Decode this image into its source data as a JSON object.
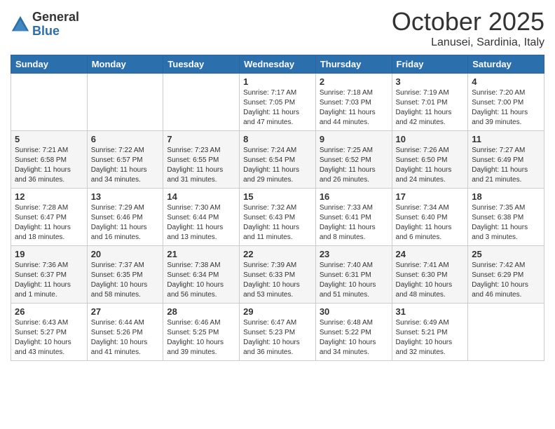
{
  "logo": {
    "general": "General",
    "blue": "Blue"
  },
  "header": {
    "month": "October 2025",
    "location": "Lanusei, Sardinia, Italy"
  },
  "days_of_week": [
    "Sunday",
    "Monday",
    "Tuesday",
    "Wednesday",
    "Thursday",
    "Friday",
    "Saturday"
  ],
  "weeks": [
    [
      {
        "day": "",
        "info": ""
      },
      {
        "day": "",
        "info": ""
      },
      {
        "day": "",
        "info": ""
      },
      {
        "day": "1",
        "info": "Sunrise: 7:17 AM\nSunset: 7:05 PM\nDaylight: 11 hours and 47 minutes."
      },
      {
        "day": "2",
        "info": "Sunrise: 7:18 AM\nSunset: 7:03 PM\nDaylight: 11 hours and 44 minutes."
      },
      {
        "day": "3",
        "info": "Sunrise: 7:19 AM\nSunset: 7:01 PM\nDaylight: 11 hours and 42 minutes."
      },
      {
        "day": "4",
        "info": "Sunrise: 7:20 AM\nSunset: 7:00 PM\nDaylight: 11 hours and 39 minutes."
      }
    ],
    [
      {
        "day": "5",
        "info": "Sunrise: 7:21 AM\nSunset: 6:58 PM\nDaylight: 11 hours and 36 minutes."
      },
      {
        "day": "6",
        "info": "Sunrise: 7:22 AM\nSunset: 6:57 PM\nDaylight: 11 hours and 34 minutes."
      },
      {
        "day": "7",
        "info": "Sunrise: 7:23 AM\nSunset: 6:55 PM\nDaylight: 11 hours and 31 minutes."
      },
      {
        "day": "8",
        "info": "Sunrise: 7:24 AM\nSunset: 6:54 PM\nDaylight: 11 hours and 29 minutes."
      },
      {
        "day": "9",
        "info": "Sunrise: 7:25 AM\nSunset: 6:52 PM\nDaylight: 11 hours and 26 minutes."
      },
      {
        "day": "10",
        "info": "Sunrise: 7:26 AM\nSunset: 6:50 PM\nDaylight: 11 hours and 24 minutes."
      },
      {
        "day": "11",
        "info": "Sunrise: 7:27 AM\nSunset: 6:49 PM\nDaylight: 11 hours and 21 minutes."
      }
    ],
    [
      {
        "day": "12",
        "info": "Sunrise: 7:28 AM\nSunset: 6:47 PM\nDaylight: 11 hours and 18 minutes."
      },
      {
        "day": "13",
        "info": "Sunrise: 7:29 AM\nSunset: 6:46 PM\nDaylight: 11 hours and 16 minutes."
      },
      {
        "day": "14",
        "info": "Sunrise: 7:30 AM\nSunset: 6:44 PM\nDaylight: 11 hours and 13 minutes."
      },
      {
        "day": "15",
        "info": "Sunrise: 7:32 AM\nSunset: 6:43 PM\nDaylight: 11 hours and 11 minutes."
      },
      {
        "day": "16",
        "info": "Sunrise: 7:33 AM\nSunset: 6:41 PM\nDaylight: 11 hours and 8 minutes."
      },
      {
        "day": "17",
        "info": "Sunrise: 7:34 AM\nSunset: 6:40 PM\nDaylight: 11 hours and 6 minutes."
      },
      {
        "day": "18",
        "info": "Sunrise: 7:35 AM\nSunset: 6:38 PM\nDaylight: 11 hours and 3 minutes."
      }
    ],
    [
      {
        "day": "19",
        "info": "Sunrise: 7:36 AM\nSunset: 6:37 PM\nDaylight: 11 hours and 1 minute."
      },
      {
        "day": "20",
        "info": "Sunrise: 7:37 AM\nSunset: 6:35 PM\nDaylight: 10 hours and 58 minutes."
      },
      {
        "day": "21",
        "info": "Sunrise: 7:38 AM\nSunset: 6:34 PM\nDaylight: 10 hours and 56 minutes."
      },
      {
        "day": "22",
        "info": "Sunrise: 7:39 AM\nSunset: 6:33 PM\nDaylight: 10 hours and 53 minutes."
      },
      {
        "day": "23",
        "info": "Sunrise: 7:40 AM\nSunset: 6:31 PM\nDaylight: 10 hours and 51 minutes."
      },
      {
        "day": "24",
        "info": "Sunrise: 7:41 AM\nSunset: 6:30 PM\nDaylight: 10 hours and 48 minutes."
      },
      {
        "day": "25",
        "info": "Sunrise: 7:42 AM\nSunset: 6:29 PM\nDaylight: 10 hours and 46 minutes."
      }
    ],
    [
      {
        "day": "26",
        "info": "Sunrise: 6:43 AM\nSunset: 5:27 PM\nDaylight: 10 hours and 43 minutes."
      },
      {
        "day": "27",
        "info": "Sunrise: 6:44 AM\nSunset: 5:26 PM\nDaylight: 10 hours and 41 minutes."
      },
      {
        "day": "28",
        "info": "Sunrise: 6:46 AM\nSunset: 5:25 PM\nDaylight: 10 hours and 39 minutes."
      },
      {
        "day": "29",
        "info": "Sunrise: 6:47 AM\nSunset: 5:23 PM\nDaylight: 10 hours and 36 minutes."
      },
      {
        "day": "30",
        "info": "Sunrise: 6:48 AM\nSunset: 5:22 PM\nDaylight: 10 hours and 34 minutes."
      },
      {
        "day": "31",
        "info": "Sunrise: 6:49 AM\nSunset: 5:21 PM\nDaylight: 10 hours and 32 minutes."
      },
      {
        "day": "",
        "info": ""
      }
    ]
  ]
}
